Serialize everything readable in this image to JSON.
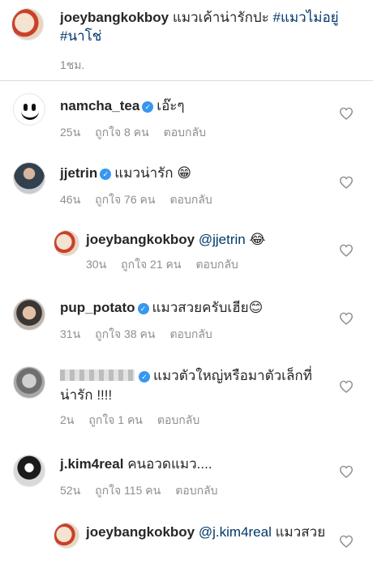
{
  "caption": {
    "username": "joeybangkokboy",
    "text": " แมวเค้าน่ารักปะ ",
    "hashtag1": "#แมวไม่อยู่",
    "hashtag2": "#นาโช่",
    "time": "1ชม."
  },
  "labels": {
    "likes_prefix": "ถูกใจ",
    "likes_suffix": "คน",
    "reply": "ตอบกลับ"
  },
  "comments": [
    {
      "username": "namcha_tea",
      "verified": true,
      "text": "เอ๊ะๆ",
      "time": "25น",
      "likes": "8"
    },
    {
      "username": "jjetrin",
      "verified": true,
      "text": "แมวน่ารัก 😁",
      "time": "46น",
      "likes": "76"
    },
    {
      "username": "joeybangkokboy",
      "mention": "@jjetrin",
      "text": " 😂",
      "time": "30น",
      "likes": "21"
    },
    {
      "username": "pup_potato",
      "verified": true,
      "text": "แมวสวยครับเฮีย😊",
      "time": "31น",
      "likes": "38"
    },
    {
      "username": "",
      "verified": true,
      "text": "แมวตัวใหญ่หรือมาตัวเล็กที่น่ารัก !!!!",
      "time": "2น",
      "likes": "1"
    },
    {
      "username": "j.kim4real",
      "text": "คนอวดแมว....",
      "time": "52น",
      "likes": "115"
    },
    {
      "username": "joeybangkokboy",
      "mention": "@j.kim4real",
      "text": " แมวสวย"
    }
  ],
  "colors": {
    "link": "#00376b",
    "meta": "#8e8e8e",
    "verified": "#3897f0"
  },
  "icons": [
    "heart-outline-icon",
    "verified-badge-icon"
  ]
}
